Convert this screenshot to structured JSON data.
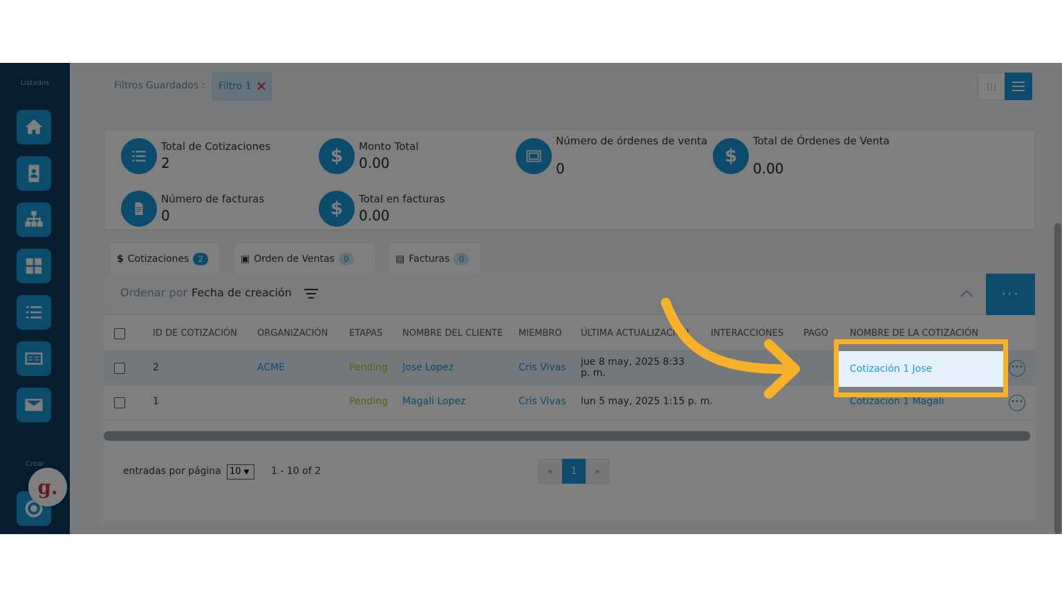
{
  "sidebar": {
    "title": "Listados",
    "crear_label": "Crear",
    "items": [
      {
        "icon": "home-icon"
      },
      {
        "icon": "contact-card-icon"
      },
      {
        "icon": "org-chart-icon"
      },
      {
        "icon": "grid-icon"
      },
      {
        "icon": "list-icon"
      },
      {
        "icon": "billing-icon"
      },
      {
        "icon": "mail-icon"
      },
      {
        "icon": "target-icon"
      }
    ],
    "logo_letter": "g."
  },
  "filters": {
    "label": "Filtros Guardados :",
    "chip_label": "Filtro 1",
    "chip_close": "✕"
  },
  "stats": [
    {
      "label": "Total de Cotizaciones",
      "value": "2",
      "icon": "list-icon"
    },
    {
      "label": "Monto Total",
      "value": "0.00",
      "icon": "dollar-icon"
    },
    {
      "label": "Número de órdenes de venta",
      "value": "0",
      "icon": "sales-order-icon"
    },
    {
      "label": "Total de Órdenes de Venta",
      "value": "0.00",
      "icon": "dollar-icon"
    },
    {
      "label": "Número de facturas",
      "value": "0",
      "icon": "invoice-icon"
    },
    {
      "label": "Total en facturas",
      "value": "0.00",
      "icon": "dollar-icon"
    }
  ],
  "tabs": [
    {
      "label": "Cotizaciones",
      "count": "2",
      "icon": "$"
    },
    {
      "label": "Orden de Ventas",
      "count": "0",
      "icon": "▣"
    },
    {
      "label": "Facturas",
      "count": "0",
      "icon": "▤"
    }
  ],
  "sort": {
    "prefix": "Ordenar por",
    "field": "Fecha de creación",
    "more": "···"
  },
  "table": {
    "headers": [
      "ID DE COTIZACIÓN",
      "ORGANIZACIÓN",
      "ETAPAS",
      "NOMBRE DEL CLIENTE",
      "MIEMBRO",
      "ÚLTIMA ACTUALIZACIÓN",
      "INTERACCIONES",
      "PAGO",
      "NOMBRE DE LA COTIZACIÓN"
    ],
    "rows": [
      {
        "id": "2",
        "org": "ACME",
        "stage": "Pending",
        "client": "Jose Lopez",
        "member": "Cris Vivas",
        "updated_1": "jue 8 may, 2025 8:33",
        "updated_2": "p. m.",
        "quote": "Cotización 1 Jose"
      },
      {
        "id": "1",
        "org": "",
        "stage": "Pending",
        "client": "Magali Lopez",
        "member": "Cris Vivas",
        "updated_1": "lun 5 may, 2025 1:15 p. m.",
        "updated_2": "",
        "quote": "Cotización 1 Magali"
      }
    ]
  },
  "pagination": {
    "per_page_label": "entradas por página",
    "per_page": "10",
    "range": "1 - 10 of 2",
    "prev": "«",
    "current": "1",
    "next": "»"
  },
  "colors": {
    "accent": "#1a96d8",
    "highlight": "#f7b22a",
    "sidebar": "#0a3a5c"
  }
}
